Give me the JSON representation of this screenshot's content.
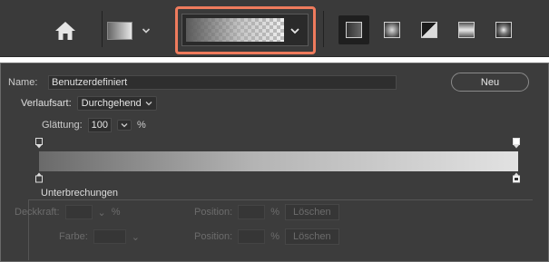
{
  "colors": {
    "toolbar_bg": "#3a3a3a",
    "panel_bg": "#3c3c3c",
    "highlight": "#ee7b5d"
  },
  "toolbar": {
    "home_icon": "home-icon",
    "gradient_swatch_icon": "gradient-swatch-icon",
    "preset_picker_icon": "gradient-preset-picker",
    "styles": [
      {
        "name": "linear-gradient-icon",
        "active": true
      },
      {
        "name": "radial-gradient-icon",
        "active": false
      },
      {
        "name": "angle-gradient-icon",
        "active": false
      },
      {
        "name": "reflected-gradient-icon",
        "active": false
      },
      {
        "name": "diamond-gradient-icon",
        "active": false
      }
    ]
  },
  "editor": {
    "name_label": "Name:",
    "name_value": "Benutzerdefiniert",
    "new_button": "Neu",
    "type_label": "Verlaufsart:",
    "type_value": "Durchgehend",
    "smoothness_label": "Glättung:",
    "smoothness_value": "100",
    "smoothness_unit": "%",
    "stops_header": "Unterbrechungen",
    "opacity_label": "Deckkraft:",
    "opacity_unit": "%",
    "color_label": "Farbe:",
    "position_label": "Position:",
    "position_unit": "%",
    "delete_button": "Löschen"
  }
}
